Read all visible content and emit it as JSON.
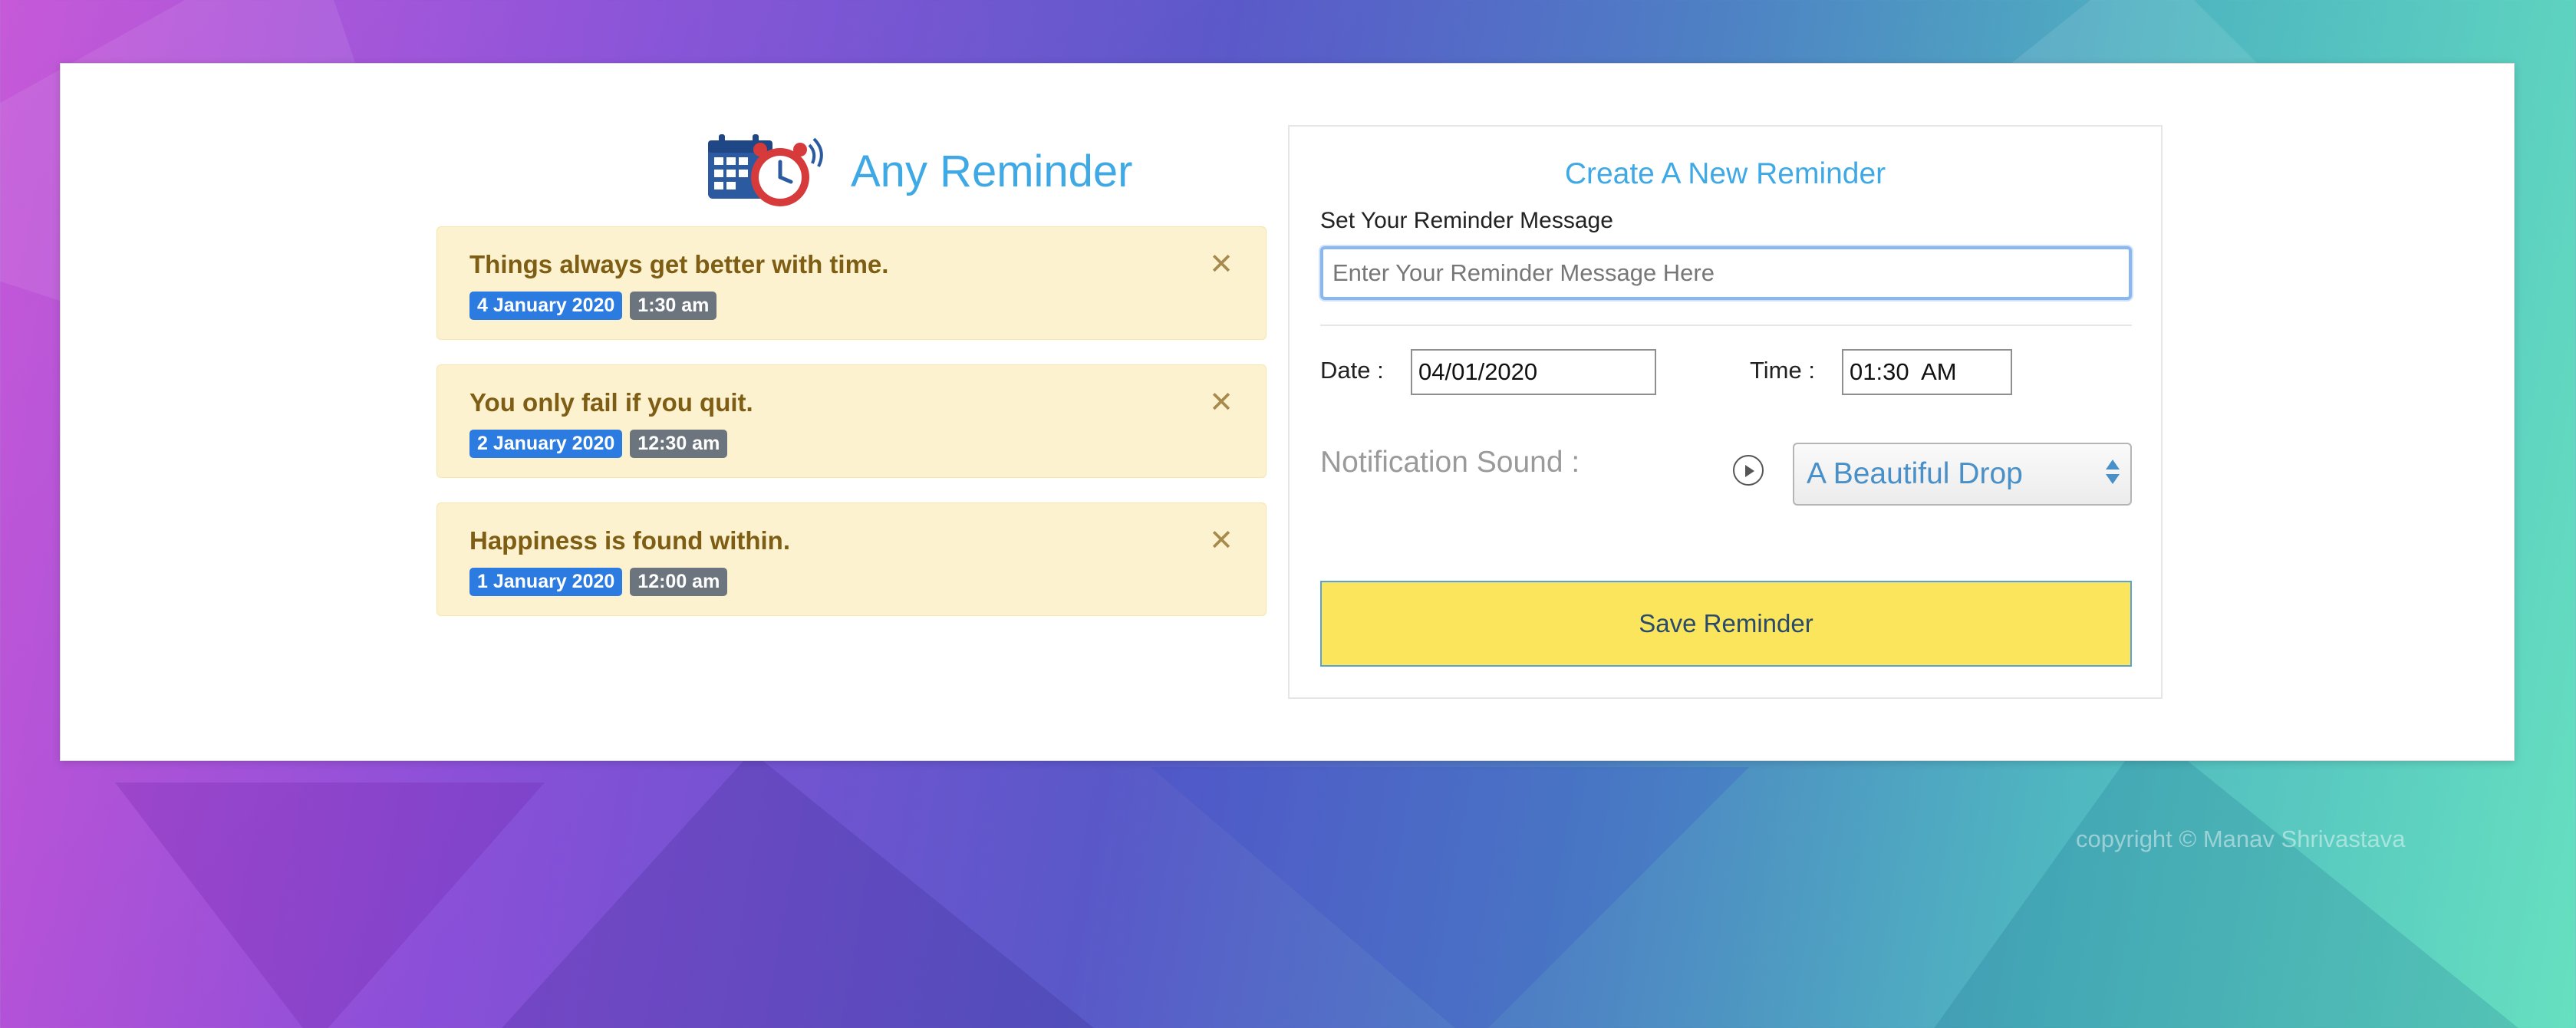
{
  "app": {
    "title": "Any Reminder"
  },
  "reminders": [
    {
      "message": "Things always get better with time.",
      "date": "4 January 2020",
      "time": "1:30 am",
      "close": "✕"
    },
    {
      "message": "You only fail if you quit.",
      "date": "2 January 2020",
      "time": "12:30 am",
      "close": "✕"
    },
    {
      "message": "Happiness is found within.",
      "date": "1 January 2020",
      "time": "12:00 am",
      "close": "✕"
    }
  ],
  "form": {
    "title": "Create A New Reminder",
    "message_label": "Set Your Reminder Message",
    "message_placeholder": "Enter Your Reminder Message Here",
    "message_value": "",
    "date_label": "Date  :",
    "date_value": "04/01/2020",
    "time_label": "Time  :",
    "time_value": "01:30  AM",
    "sound_label": "Notification Sound   :",
    "sound_selected": "A Beautiful Drop",
    "save_label": "Save Reminder"
  },
  "footer": {
    "copyright": "copyright © Manav Shrivastava"
  },
  "icons": {
    "logo": "calendar-alarm-clock-icon",
    "close": "close-icon",
    "play": "play-circle-icon",
    "select_arrows": "up-down-arrows-icon"
  },
  "colors": {
    "accent_blue": "#3fa9e6",
    "alert_bg": "#fcf2cf",
    "alert_text": "#7e5e14",
    "date_badge": "#2b7be0",
    "time_badge": "#6c757d",
    "save_button": "#fae55c"
  }
}
